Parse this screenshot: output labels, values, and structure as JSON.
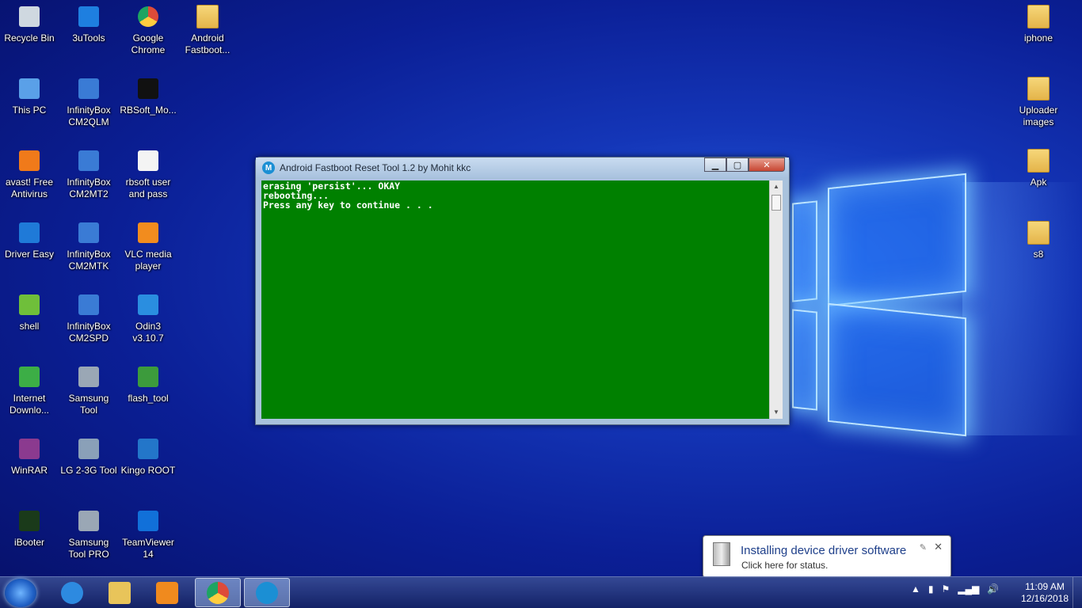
{
  "desktop": {
    "icons_left": [
      {
        "label": "Recycle Bin",
        "icon": "recycle-bin-icon"
      },
      {
        "label": "3uTools",
        "icon": "3utools-icon"
      },
      {
        "label": "Google\nChrome",
        "icon": "chrome-icon"
      },
      {
        "label": "Android\nFastboot...",
        "icon": "folder-icon"
      },
      {
        "label": "This PC",
        "icon": "this-pc-icon"
      },
      {
        "label": "InfinityBox\nCM2QLM",
        "icon": "infinitybox-qlm-icon"
      },
      {
        "label": "RBSoft_Mo...",
        "icon": "rbsoft-icon"
      },
      {
        "label": "avast! Free\nAntivirus",
        "icon": "avast-icon"
      },
      {
        "label": "InfinityBox\nCM2MT2",
        "icon": "infinitybox-mtk-icon"
      },
      {
        "label": "rbsoft user\nand pass",
        "icon": "text-file-icon"
      },
      {
        "label": "Driver Easy",
        "icon": "driver-easy-icon"
      },
      {
        "label": "InfinityBox\nCM2MTK",
        "icon": "infinitybox-mtk-icon"
      },
      {
        "label": "VLC media\nplayer",
        "icon": "vlc-icon"
      },
      {
        "label": "shell",
        "icon": "shell-icon"
      },
      {
        "label": "InfinityBox\nCM2SPD",
        "icon": "infinitybox-spd-icon"
      },
      {
        "label": "Odin3 v3.10.7",
        "icon": "odin-icon"
      },
      {
        "label": "Internet\nDownlo...",
        "icon": "idm-icon"
      },
      {
        "label": "Samsung\nTool",
        "icon": "samsung-tool-icon"
      },
      {
        "label": "flash_tool",
        "icon": "flash-tool-icon"
      },
      {
        "label": "WinRAR",
        "icon": "winrar-icon"
      },
      {
        "label": "LG 2-3G Tool",
        "icon": "lg-tool-icon"
      },
      {
        "label": "Kingo ROOT",
        "icon": "kingo-root-icon"
      },
      {
        "label": "iBooter",
        "icon": "ibooter-icon"
      },
      {
        "label": "Samsung\nTool PRO",
        "icon": "samsung-tool-pro-icon"
      },
      {
        "label": "TeamViewer\n14",
        "icon": "teamviewer-icon"
      }
    ],
    "icons_right": [
      {
        "label": "iphone",
        "icon": "folder-icon"
      },
      {
        "label": "Uploader\nimages",
        "icon": "folder-icon"
      },
      {
        "label": "Apk",
        "icon": "folder-icon"
      },
      {
        "label": "s8",
        "icon": "folder-icon"
      }
    ]
  },
  "console_window": {
    "title": "Android Fastboot Reset Tool 1.2 by Mohit kkc",
    "lines": [
      "erasing 'persist'... OKAY",
      "rebooting...",
      "Press any key to continue . . ."
    ],
    "controls": {
      "minimize": "▁",
      "maximize": "▢",
      "close": "✕"
    },
    "background": "#008000"
  },
  "notification": {
    "title": "Installing device driver software",
    "subtitle": "Click here for status."
  },
  "taskbar": {
    "apps": [
      {
        "name": "internet-explorer",
        "color": "#2d8ae0"
      },
      {
        "name": "file-explorer",
        "color": "#e8c45a"
      },
      {
        "name": "media-player",
        "color": "#f08a1e"
      },
      {
        "name": "google-chrome",
        "color": "#dd4b39"
      },
      {
        "name": "motorola-app",
        "color": "#1b8fd4"
      }
    ],
    "clock_time": "11:09 AM",
    "clock_date": "12/16/2018"
  }
}
